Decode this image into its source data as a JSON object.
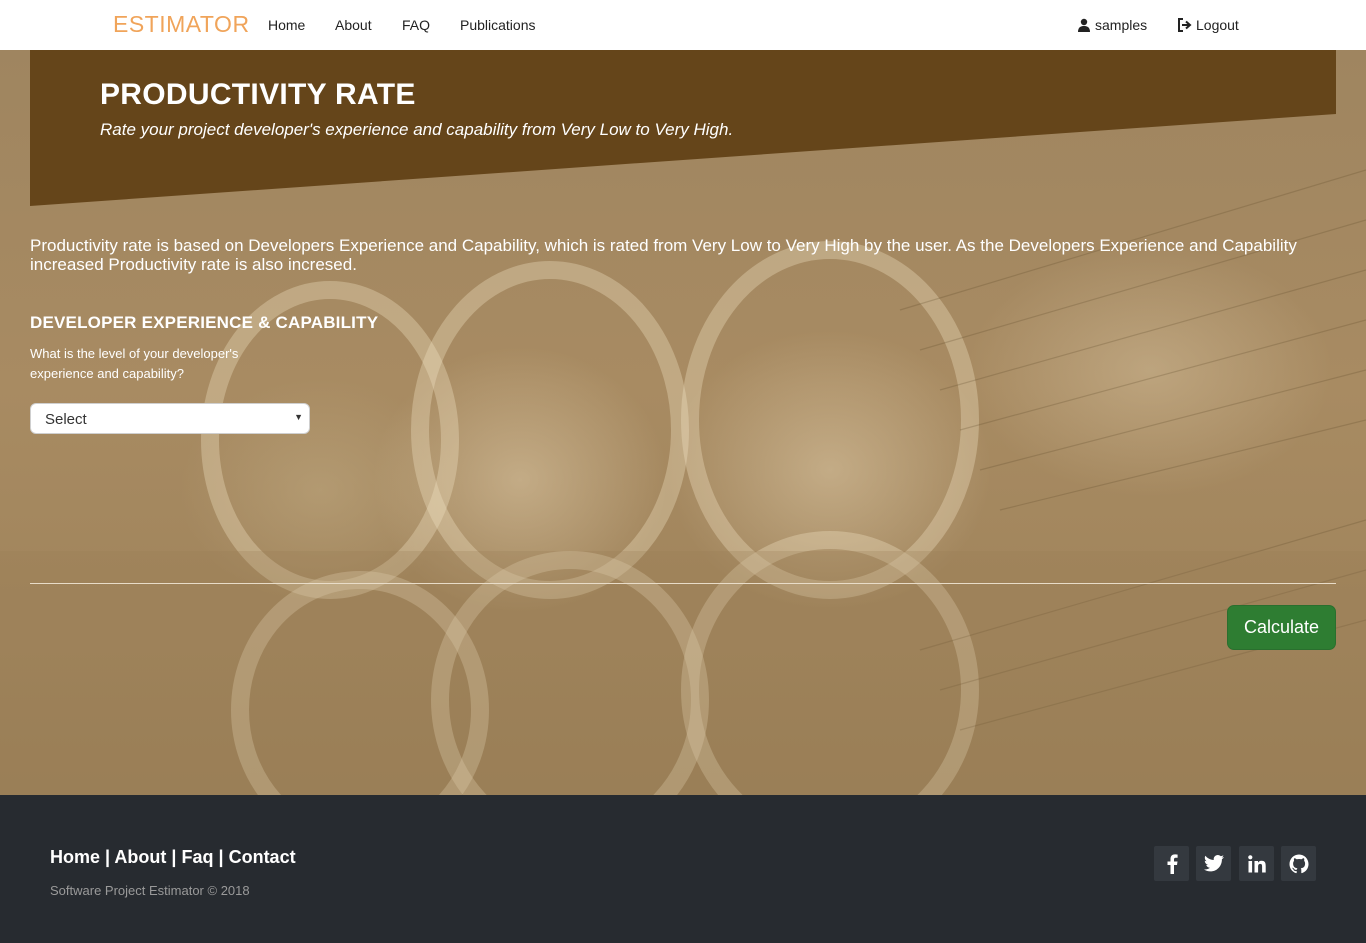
{
  "navbar": {
    "brand": "ESTIMATOR",
    "links": [
      "Home",
      "About",
      "FAQ",
      "Publications"
    ],
    "user_label": "samples",
    "logout_label": "Logout",
    "brand_color": "#f0a45a"
  },
  "header": {
    "title": "PRODUCTIVITY RATE",
    "subtitle": "Rate your project developer's experience and capability from Very Low to Very High.",
    "banner_color": "#65451a"
  },
  "main": {
    "intro": "Productivity rate is based on Developers Experience and Capability, which is rated from Very Low to Very High by the user. As the Developers Experience and Capability increased Productivity rate is also incresed.",
    "section_title": "DEVELOPER EXPERIENCE & CAPABILITY",
    "question": "What is the level of your developer's experience and capability?",
    "select_value": "Select",
    "calculate_label": "Calculate",
    "button_color": "#2e7d32"
  },
  "footer": {
    "links": [
      "Home",
      "About",
      "Faq",
      "Contact"
    ],
    "separator": "|",
    "copyright": "Software Project Estimator © 2018",
    "social_icons": [
      "facebook-icon",
      "twitter-icon",
      "linkedin-icon",
      "github-icon"
    ],
    "background": "#272b30"
  }
}
